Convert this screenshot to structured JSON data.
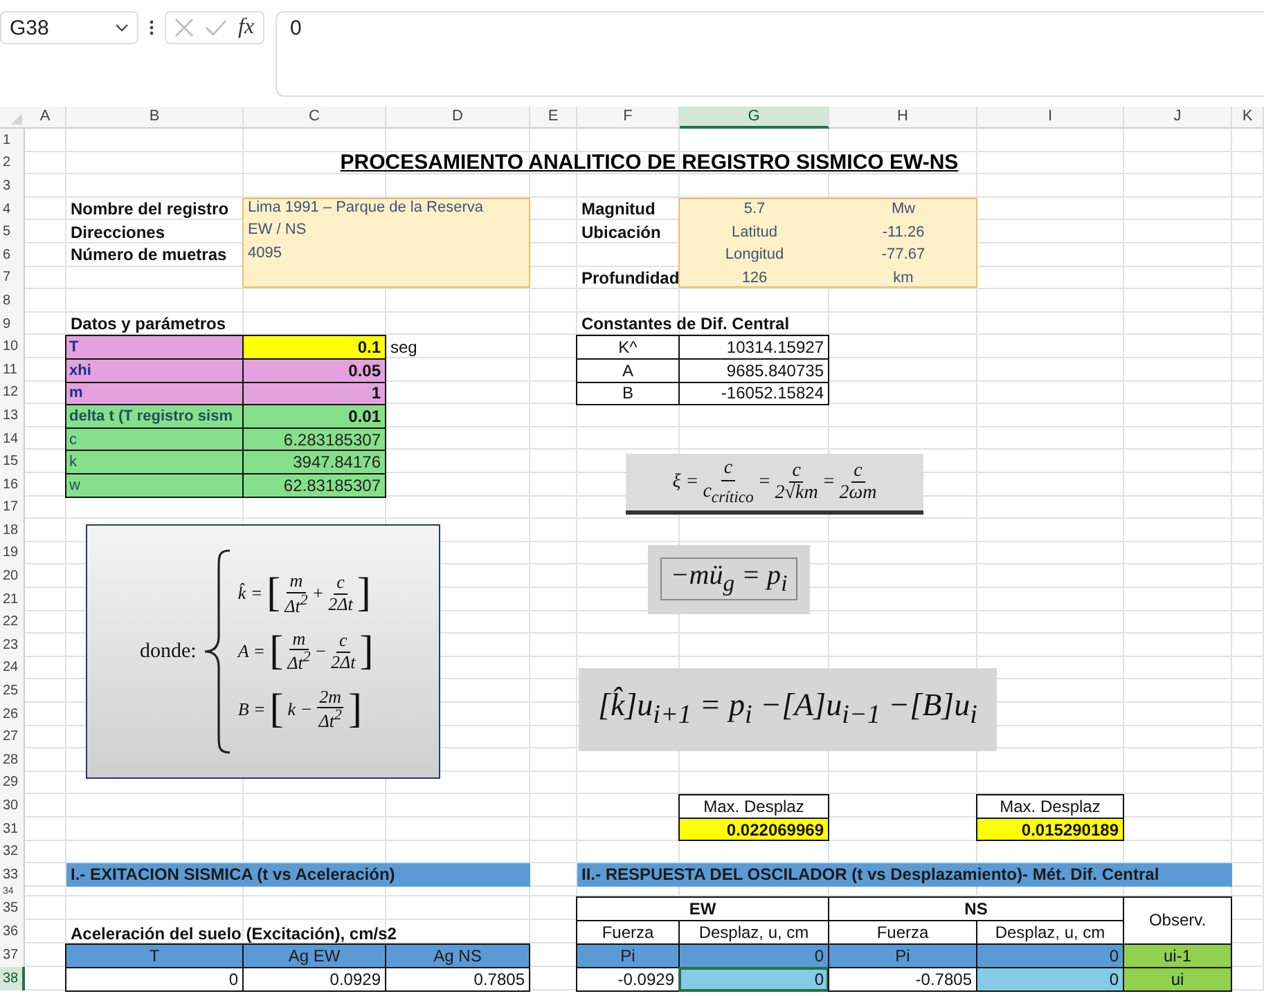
{
  "formula_bar": {
    "cell_ref": "G38",
    "function_label": "fx",
    "value": "0"
  },
  "columns": [
    {
      "label": "A",
      "selected": false
    },
    {
      "label": "B",
      "selected": false
    },
    {
      "label": "C",
      "selected": false
    },
    {
      "label": "D",
      "selected": false
    },
    {
      "label": "E",
      "selected": false
    },
    {
      "label": "F",
      "selected": false
    },
    {
      "label": "G",
      "selected": true
    },
    {
      "label": "H",
      "selected": false
    },
    {
      "label": "I",
      "selected": false
    },
    {
      "label": "J",
      "selected": false
    },
    {
      "label": "K",
      "selected": false
    }
  ],
  "rows": [
    {
      "label": "1",
      "selected": false
    },
    {
      "label": "2",
      "selected": false
    },
    {
      "label": "3",
      "selected": false
    },
    {
      "label": "4",
      "selected": false
    },
    {
      "label": "5",
      "selected": false
    },
    {
      "label": "6",
      "selected": false
    },
    {
      "label": "7",
      "selected": false
    },
    {
      "label": "8",
      "selected": false
    },
    {
      "label": "9",
      "selected": false
    },
    {
      "label": "10",
      "selected": false
    },
    {
      "label": "11",
      "selected": false
    },
    {
      "label": "12",
      "selected": false
    },
    {
      "label": "13",
      "selected": false
    },
    {
      "label": "14",
      "selected": false
    },
    {
      "label": "15",
      "selected": false
    },
    {
      "label": "16",
      "selected": false
    },
    {
      "label": "17",
      "selected": false
    },
    {
      "label": "18",
      "selected": false
    },
    {
      "label": "19",
      "selected": false
    },
    {
      "label": "20",
      "selected": false
    },
    {
      "label": "21",
      "selected": false
    },
    {
      "label": "22",
      "selected": false
    },
    {
      "label": "23",
      "selected": false
    },
    {
      "label": "24",
      "selected": false
    },
    {
      "label": "25",
      "selected": false
    },
    {
      "label": "26",
      "selected": false
    },
    {
      "label": "27",
      "selected": false
    },
    {
      "label": "28",
      "selected": false
    },
    {
      "label": "29",
      "selected": false
    },
    {
      "label": "30",
      "selected": false
    },
    {
      "label": "31",
      "selected": false
    },
    {
      "label": "32",
      "selected": false
    },
    {
      "label": "33",
      "selected": false
    },
    {
      "label": "34",
      "selected": false
    },
    {
      "label": "35",
      "selected": false
    },
    {
      "label": "36",
      "selected": false
    },
    {
      "label": "37",
      "selected": false
    },
    {
      "label": "38",
      "selected": true
    }
  ],
  "title": "PROCESAMIENTO ANALITICO DE REGISTRO SISMICO EW-NS",
  "record_info": [
    {
      "label": "Nombre del registro",
      "value": "Lima 1991 – Parque de la Reserva"
    },
    {
      "label": "Direcciones",
      "value": "EW / NS"
    },
    {
      "label": "Número de muetras",
      "value": "4095"
    }
  ],
  "quake_info": [
    {
      "label": "Magnitud",
      "values": [
        "5.7",
        "Mw"
      ]
    },
    {
      "label": "Ubicación",
      "values": [
        "Latitud",
        "-11.26"
      ]
    },
    {
      "values": [
        "Longitud",
        "-77.67"
      ]
    },
    {
      "label": "Profundidad",
      "values": [
        "126",
        "km"
      ]
    }
  ],
  "parameters": {
    "title": "Datos y parámetros",
    "rows": [
      {
        "label": "T",
        "value": "0.1",
        "kind": "input",
        "highlight": true,
        "unit": "seg"
      },
      {
        "label": "xhi",
        "value": "0.05",
        "kind": "input",
        "highlight": false
      },
      {
        "label": "m",
        "value": "1",
        "kind": "input",
        "highlight": false
      },
      {
        "label": "delta t (T registro sism",
        "value": "0.01",
        "kind": "step",
        "highlight": false
      },
      {
        "label": "c",
        "value": "6.283185307",
        "kind": "derived",
        "highlight": false
      },
      {
        "label": "k",
        "value": "3947.84176",
        "kind": "derived",
        "highlight": false
      },
      {
        "label": "w",
        "value": "62.83185307",
        "kind": "derived",
        "highlight": false
      }
    ]
  },
  "constants": {
    "title": "Constantes de Dif. Central",
    "rows": [
      {
        "label": "K^",
        "value": "10314.15927"
      },
      {
        "label": "A",
        "value": "9685.840735"
      },
      {
        "label": "B",
        "value": "-16052.15824"
      }
    ]
  },
  "formulas": {
    "damping": [
      {
        "kind": "text",
        "text": "ξ ="
      },
      {
        "kind": "frac",
        "num": "c",
        "den": "c$_{crítico}$"
      },
      {
        "kind": "text",
        "text": "="
      },
      {
        "kind": "frac",
        "num": "c",
        "den": "2√km"
      },
      {
        "kind": "text",
        "text": "="
      },
      {
        "kind": "frac",
        "num": "c",
        "den": "2ωm"
      }
    ],
    "donde": {
      "label": "donde:",
      "equations": [
        [
          {
            "kind": "text",
            "text": "k̂ ="
          },
          {
            "kind": "bracket",
            "text": "["
          },
          {
            "kind": "frac",
            "num": "m",
            "den": "Δt$^{2}$"
          },
          {
            "kind": "text",
            "text": "+"
          },
          {
            "kind": "frac",
            "num": "c",
            "den": "2Δt"
          },
          {
            "kind": "bracket",
            "text": "]"
          }
        ],
        [
          {
            "kind": "text",
            "text": "A ="
          },
          {
            "kind": "bracket",
            "text": "["
          },
          {
            "kind": "frac",
            "num": "m",
            "den": "Δt$^{2}$"
          },
          {
            "kind": "text",
            "text": "−"
          },
          {
            "kind": "frac",
            "num": "c",
            "den": "2Δt"
          },
          {
            "kind": "bracket",
            "text": "]"
          }
        ],
        [
          {
            "kind": "text",
            "text": "B ="
          },
          {
            "kind": "bracket",
            "text": "["
          },
          {
            "kind": "text",
            "text": "k −"
          },
          {
            "kind": "frac",
            "num": "2m",
            "den": "Δt$^{2}$"
          },
          {
            "kind": "bracket",
            "text": "]"
          }
        ]
      ]
    },
    "load": [
      {
        "kind": "text",
        "text": "−mü$_{g}$ = p$_{i}$"
      }
    ],
    "recurrence": [
      {
        "kind": "text",
        "text": "[k̂]u$_{i+1}$ = p$_{i}$ −[A]u$_{i−1}$ −[B]u$_{i}$"
      }
    ]
  },
  "max_displacements": [
    {
      "label": "Max. Desplaz",
      "value": "0.022069969"
    },
    {
      "label": "Max. Desplaz",
      "value": "0.015290189"
    }
  ],
  "sections": [
    "I.- EXITACION SISMICA (t vs Aceleración)",
    "II.- RESPUESTA DEL OSCILADOR (t vs Desplazamiento)- Mét. Dif. Central"
  ],
  "excitation": {
    "caption": "Aceleración del suelo (Excitación), cm/s2",
    "columns": [
      "T",
      "Ag EW",
      "Ag NS"
    ],
    "rows": [
      [
        "0",
        "0.0929",
        "0.7805"
      ]
    ]
  },
  "response": {
    "groups": [
      "EW",
      "NS"
    ],
    "observ_header": "Observ.",
    "subheaders": [
      "Fuerza",
      "Desplaz, u, cm",
      "Fuerza",
      "Desplaz, u, cm"
    ],
    "rows": [
      {
        "kind": "header",
        "cells": [
          {
            "text": "Pi",
            "selected": false
          },
          {
            "text": "0",
            "selected": false
          },
          {
            "text": "Pi",
            "selected": false
          },
          {
            "text": "0",
            "selected": false
          }
        ],
        "obs": "ui-1"
      },
      {
        "kind": "data",
        "cells": [
          {
            "text": "-0.0929",
            "selected": false
          },
          {
            "text": "0",
            "selected": true
          },
          {
            "text": "-0.7805",
            "selected": false
          },
          {
            "text": "0",
            "selected": false
          }
        ],
        "obs": "ui"
      }
    ]
  }
}
